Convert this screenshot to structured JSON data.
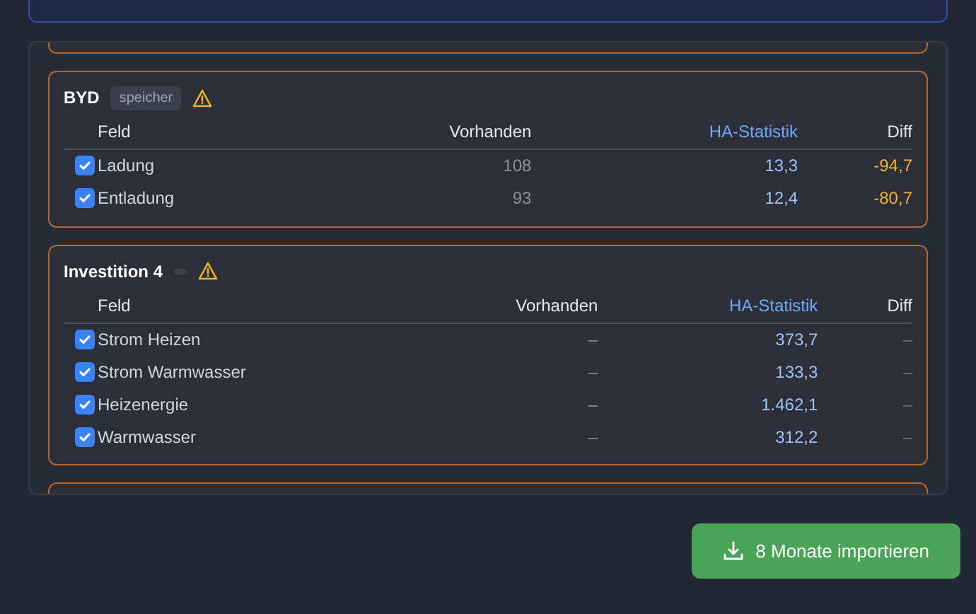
{
  "cards": [
    {
      "title": "BYD",
      "tag": "speicher",
      "warning": true,
      "columns": [
        "Feld",
        "Vorhanden",
        "HA-Statistik",
        "Diff"
      ],
      "rows": [
        {
          "checked": true,
          "field": "Ladung",
          "existing": "108",
          "ha": "13,3",
          "diff": "-94,7",
          "flagged": true
        },
        {
          "checked": true,
          "field": "Entladung",
          "existing": "93",
          "ha": "12,4",
          "diff": "-80,7",
          "flagged": true
        }
      ]
    },
    {
      "title": "Investition 4",
      "empty_tag": true,
      "warning": true,
      "columns": [
        "Feld",
        "Vorhanden",
        "HA-Statistik",
        "Diff"
      ],
      "rows": [
        {
          "checked": true,
          "field": "Strom Heizen",
          "existing": "–",
          "ha": "373,7",
          "diff": "–",
          "flagged": false
        },
        {
          "checked": true,
          "field": "Strom Warmwasser",
          "existing": "–",
          "ha": "133,3",
          "diff": "–",
          "flagged": false
        },
        {
          "checked": true,
          "field": "Heizenergie",
          "existing": "–",
          "ha": "1.462,1",
          "diff": "–",
          "flagged": false
        },
        {
          "checked": true,
          "field": "Warmwasser",
          "existing": "–",
          "ha": "312,2",
          "diff": "–",
          "flagged": false
        }
      ]
    }
  ],
  "import_button": {
    "label": "8 Monate importieren"
  }
}
